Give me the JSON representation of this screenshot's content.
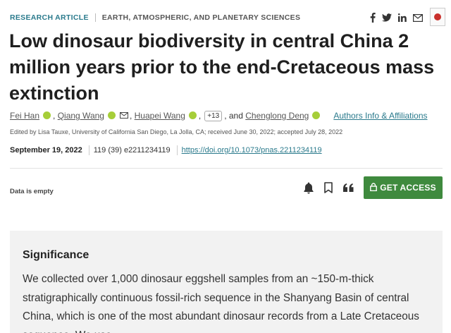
{
  "header": {
    "article_type": "RESEARCH ARTICLE",
    "subject": "EARTH, ATMOSPHERIC, AND PLANETARY SCIENCES",
    "share_icons": [
      "facebook-icon",
      "twitter-icon",
      "linkedin-icon",
      "email-icon"
    ]
  },
  "title": "Low dinosaur biodiversity in central China 2 million years prior to the end-Cretaceous mass extinction",
  "authors": {
    "list": [
      "Fei Han",
      "Qiang Wang",
      "Huapei Wang",
      "Chenglong Deng"
    ],
    "more_count": "+13",
    "and_text": ", and",
    "affiliations_link": "Authors Info & Affiliations"
  },
  "edited_by": "Edited by Lisa Tauxe, University of California San Diego, La Jolla, CA; received June 30, 2022; accepted July 28, 2022",
  "publication": {
    "date": "September 19, 2022",
    "issue": "119 (39) e2211234119",
    "doi": "https://doi.org/10.1073/pnas.2211234119"
  },
  "data_status": "Data is empty",
  "actions": {
    "get_access_label": "GET ACCESS",
    "icons": [
      "bell-icon",
      "bookmark-icon",
      "cite-icon"
    ]
  },
  "significance": {
    "heading": "Significance",
    "text": "We collected over 1,000 dinosaur eggshell samples from an ~150-m-thick stratigraphically continuous fossil-rich sequence in the Shanyang Basin of central China, which is one of the most abundant dinosaur records from a Late Cretaceous sequence. We use"
  },
  "colors": {
    "accent": "#2a7a8c",
    "access_button": "#3f8a3e",
    "orcid": "#a6ce39",
    "significance_bg": "#f2f2f2"
  }
}
